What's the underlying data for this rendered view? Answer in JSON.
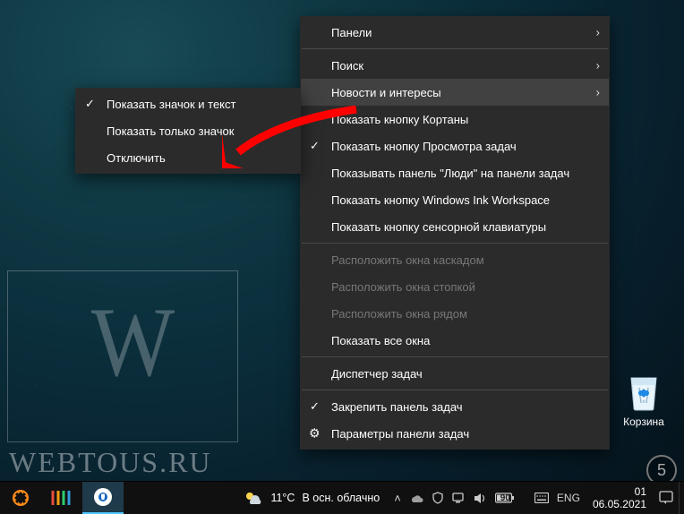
{
  "watermark": {
    "letter": "W",
    "text": "WEBTOUS.RU"
  },
  "desktop": {
    "icons": [
      {
        "label": "Корзина"
      }
    ]
  },
  "submenu": {
    "items": [
      {
        "label": "Показать значок и текст",
        "checked": true
      },
      {
        "label": "Показать только значок",
        "checked": false
      },
      {
        "label": "Отключить",
        "checked": false
      }
    ]
  },
  "mainmenu": {
    "items": [
      {
        "label": "Панели",
        "submenu": true
      },
      {
        "sep": true
      },
      {
        "label": "Поиск",
        "submenu": true
      },
      {
        "label": "Новости и интересы",
        "submenu": true,
        "hovered": true
      },
      {
        "label": "Показать кнопку Кортаны"
      },
      {
        "label": "Показать кнопку Просмотра задач",
        "checked": true
      },
      {
        "label": "Показывать панель \"Люди\" на панели задач"
      },
      {
        "label": "Показать кнопку Windows Ink Workspace"
      },
      {
        "label": "Показать кнопку сенсорной клавиатуры"
      },
      {
        "sep": true
      },
      {
        "label": "Расположить окна каскадом",
        "disabled": true
      },
      {
        "label": "Расположить окна стопкой",
        "disabled": true
      },
      {
        "label": "Расположить окна рядом",
        "disabled": true
      },
      {
        "label": "Показать все окна"
      },
      {
        "sep": true
      },
      {
        "label": "Диспетчер задач"
      },
      {
        "sep": true
      },
      {
        "label": "Закрепить панель задач",
        "checked": true
      },
      {
        "label": "Параметры панели задач",
        "icon": "gear"
      }
    ]
  },
  "taskbar": {
    "weather": {
      "temp": "11°C",
      "desc": "В осн. облачно"
    },
    "lang": "ENG",
    "battery": "90",
    "time": "01",
    "date": "06.05.2021",
    "badge": "5"
  }
}
